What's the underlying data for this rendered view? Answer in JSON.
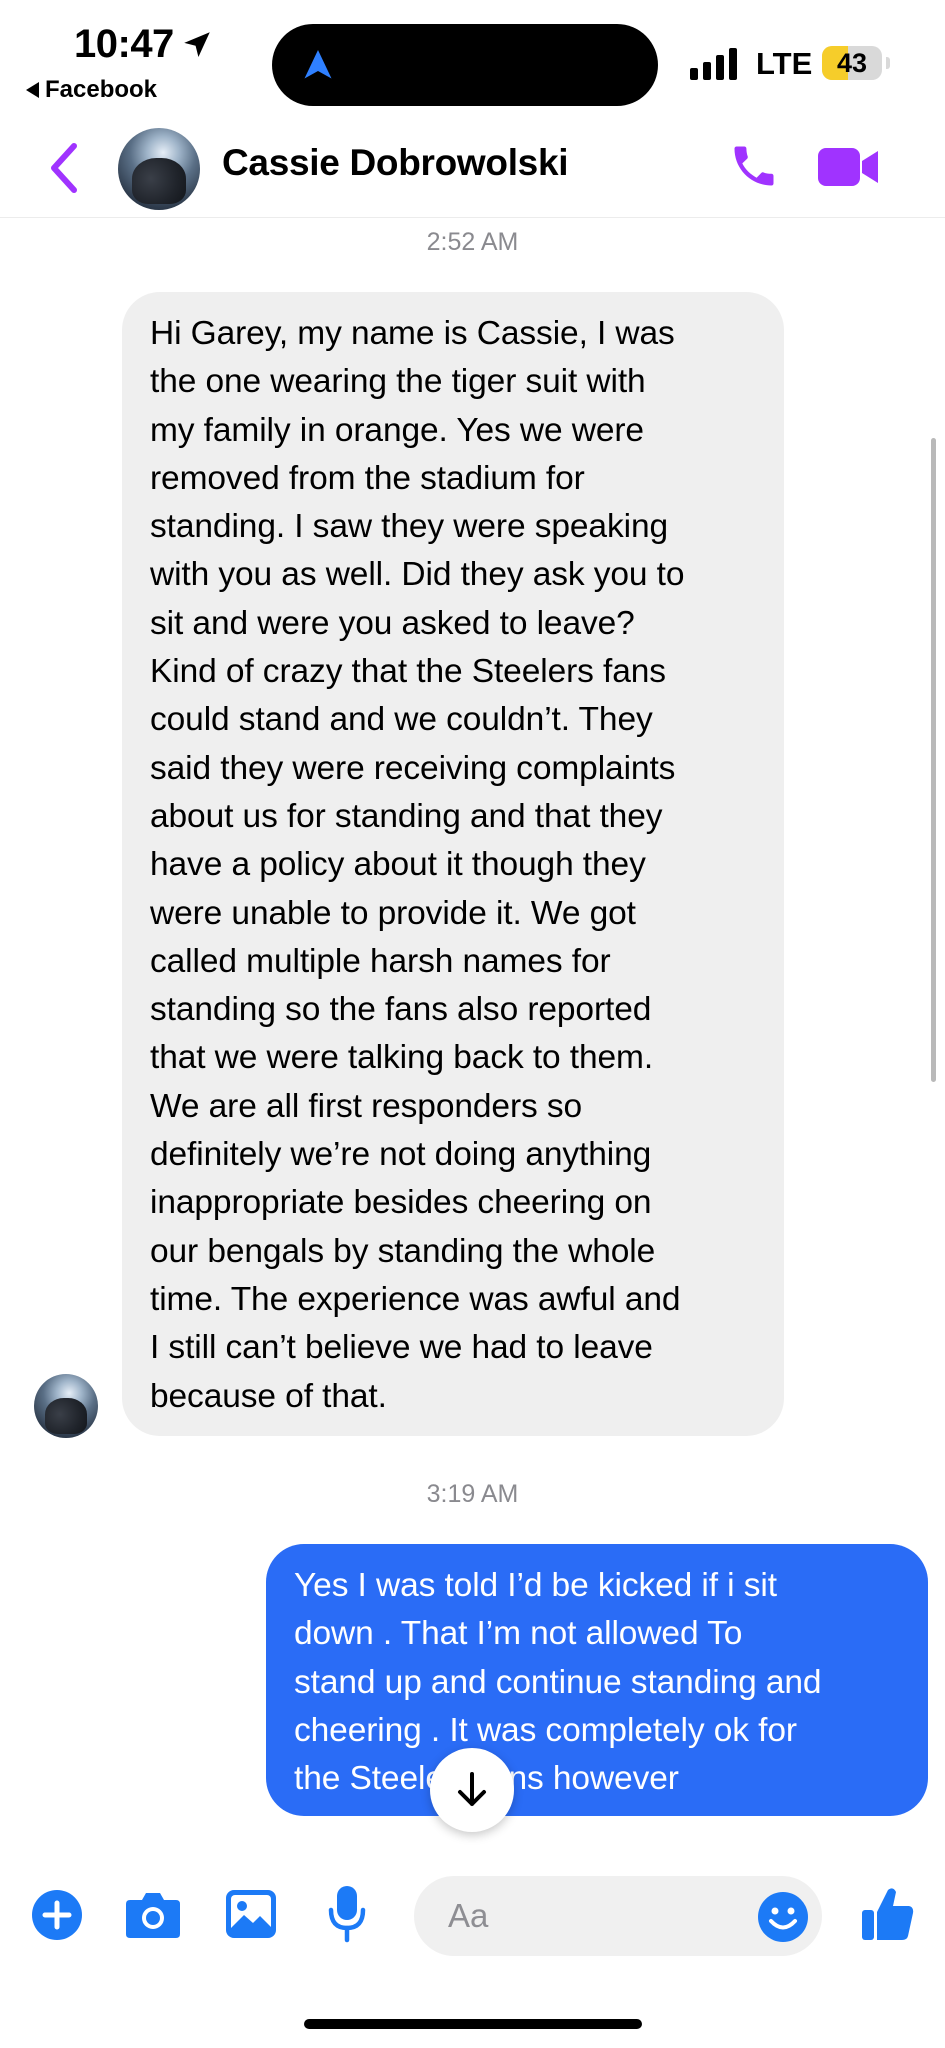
{
  "status_bar": {
    "time": "10:47",
    "back_app": "Facebook",
    "network": "LTE",
    "battery": "43",
    "battery_level_percent": 43
  },
  "header": {
    "contact_name": "Cassie Dobrowolski"
  },
  "colors": {
    "accent": "#a033ff",
    "outgoing_bubble": "#2a6cf6",
    "incoming_bubble": "#efefef",
    "composer_icon": "#1c7af6"
  },
  "conversation": {
    "timestamp_1": "2:52 AM",
    "incoming_lines": [
      "Hi Garey, my name is Cassie, I was",
      "the one wearing the tiger suit with",
      "my family in orange. Yes we were",
      "removed from the stadium for",
      "standing. I saw they were speaking",
      "with you as well. Did they ask you to",
      "sit and were you asked to leave?",
      "Kind of crazy that the Steelers fans",
      "could stand and we couldn’t. They",
      "said they were receiving complaints",
      "about us for standing and that they",
      "have a policy about it though they",
      "were unable to provide it. We got",
      "called multiple harsh names for",
      "standing so the fans also reported",
      "that we were talking back to them.",
      "We are all first responders so",
      "definitely we’re not doing anything",
      "inappropriate besides cheering on",
      "our bengals by standing the whole",
      "time. The experience was awful and",
      "I still can’t believe we had to leave",
      "because of that."
    ],
    "timestamp_2": "3:19 AM",
    "outgoing_lines": [
      "Yes I was told I’d be kicked if i sit",
      "down . That I’m not allowed To",
      "stand up and continue standing and",
      "cheering . It was completely ok for",
      "the Steelers fans however"
    ]
  },
  "composer": {
    "placeholder": "Aa",
    "icons": [
      "plus-icon",
      "camera-icon",
      "gallery-icon",
      "microphone-icon",
      "emoji-icon",
      "thumbs-up-icon"
    ]
  }
}
